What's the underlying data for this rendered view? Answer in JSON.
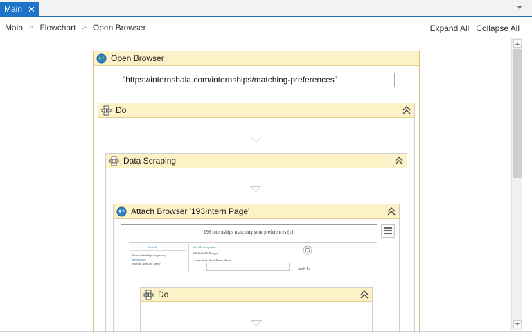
{
  "tabs": [
    {
      "label": "Main",
      "close_icon": "✕"
    }
  ],
  "breadcrumb": [
    "Main",
    "Flowchart",
    "Open Browser"
  ],
  "actions": {
    "expand_all": "Expand All",
    "collapse_all": "Collapse All"
  },
  "open_browser": {
    "title": "Open Browser",
    "url_value": "\"https://internshala.com/internships/matching-preferences\"",
    "icon": "globe-icon"
  },
  "do_outer": {
    "title": "Do",
    "icon": "sequence-icon"
  },
  "data_scraping": {
    "title": "Data Scraping",
    "icon": "sequence-icon"
  },
  "attach_browser": {
    "title": "Attach Browser '193Intern Page'",
    "icon": "globe-icon",
    "screenshot": {
      "heading": "193 internships matching your preferences [↓]",
      "line1": "Web Development",
      "line2": "NA Tech Alt Kaygn",
      "line3": "Location(s): Work From Home",
      "search_text": "Search",
      "pref1": "Show internships as per my",
      "pref2": "preferences",
      "pref3": "Starting from (or after)",
      "apply_by": "Apply By"
    }
  },
  "do_inner": {
    "title": "Do",
    "icon": "sequence-icon"
  },
  "colors": {
    "accent": "#1e74c8",
    "header_gray": "#e8eaee",
    "open_browser_header": "#fdf1c7"
  }
}
